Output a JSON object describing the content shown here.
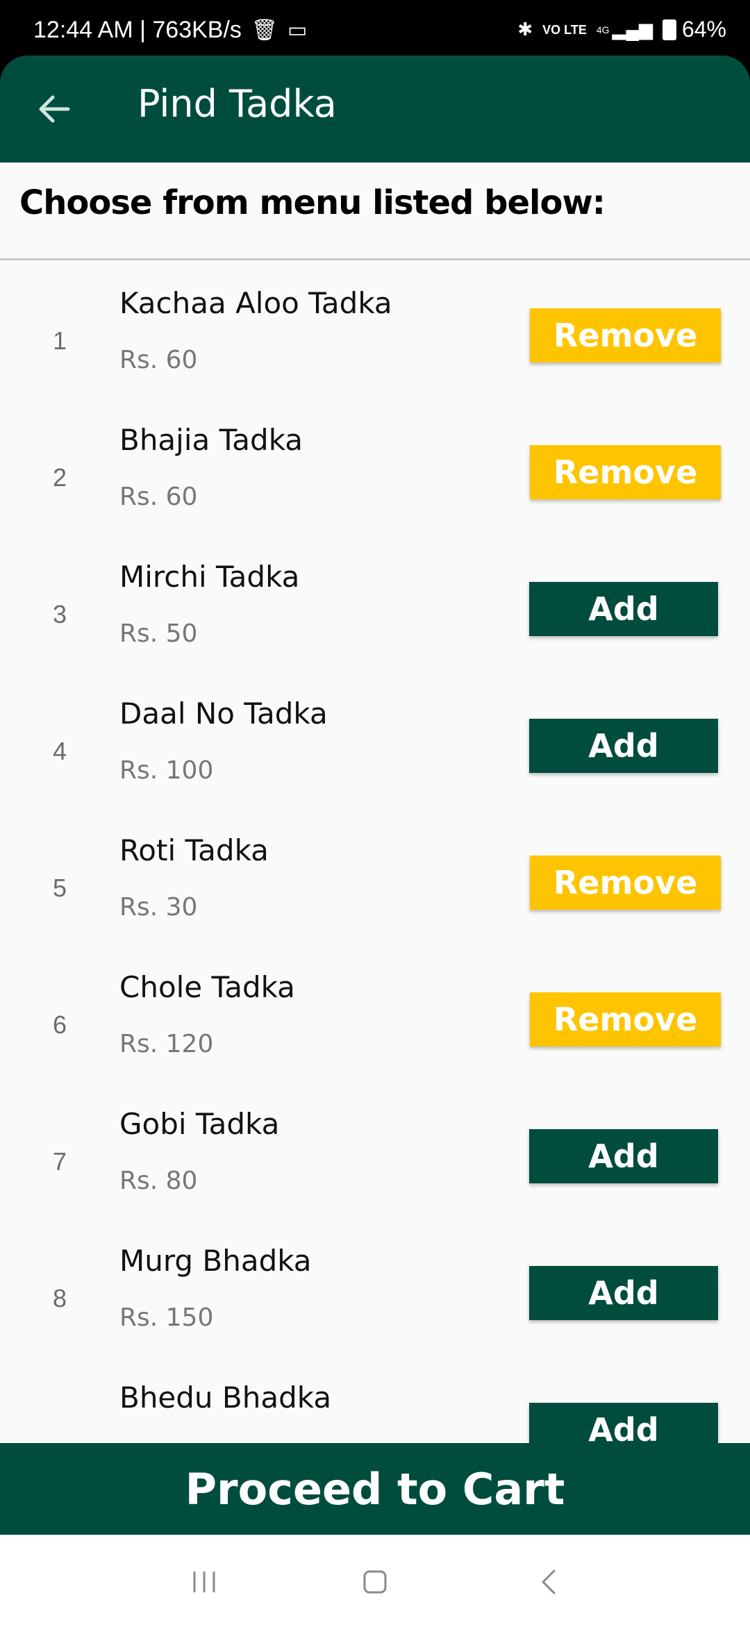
{
  "status_bar": {
    "time": "12:44 AM | 763KB/s",
    "network_volte": "VO LTE",
    "network_4g": "4G",
    "battery": "64%"
  },
  "app_bar": {
    "title": "Pind Tadka"
  },
  "heading": "Choose from menu listed below:",
  "menu_items": [
    {
      "index": "1",
      "name": "Kachaa Aloo Tadka",
      "price": "Rs. 60",
      "action": "Remove"
    },
    {
      "index": "2",
      "name": "Bhajia Tadka",
      "price": "Rs. 60",
      "action": "Remove"
    },
    {
      "index": "3",
      "name": "Mirchi Tadka",
      "price": "Rs. 50",
      "action": "Add"
    },
    {
      "index": "4",
      "name": "Daal No Tadka",
      "price": "Rs. 100",
      "action": "Add"
    },
    {
      "index": "5",
      "name": "Roti Tadka",
      "price": "Rs. 30",
      "action": "Remove"
    },
    {
      "index": "6",
      "name": "Chole Tadka",
      "price": "Rs. 120",
      "action": "Remove"
    },
    {
      "index": "7",
      "name": "Gobi Tadka",
      "price": "Rs. 80",
      "action": "Add"
    },
    {
      "index": "8",
      "name": "Murg Bhadka",
      "price": "Rs. 150",
      "action": "Add"
    },
    {
      "index": "",
      "name": "Bhedu Bhadka",
      "price": "",
      "action": "Add"
    }
  ],
  "cart_button": "Proceed to Cart",
  "colors": {
    "primary": "#004d3e",
    "remove": "#ffc400"
  }
}
